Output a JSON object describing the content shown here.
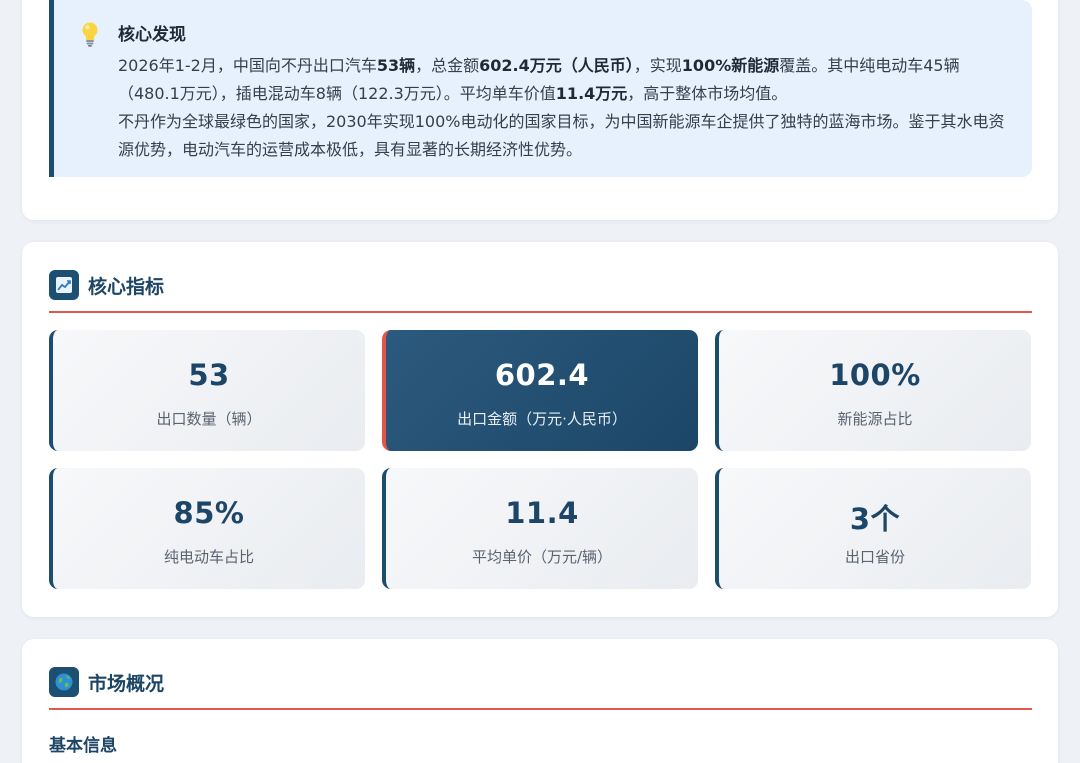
{
  "findings": {
    "icon": "lightbulb-icon",
    "title": "核心发现",
    "p1": {
      "t1": "2026年1-2月，中国向不丹出口汽车",
      "b1": "53辆",
      "t2": "，总金额",
      "b2": "602.4万元（人民币）",
      "t3": "，实现",
      "b3": "100%新能源",
      "t4": "覆盖。其中纯电动车45辆（480.1万元），插电混动车8辆（122.3万元）。平均单车价值",
      "b4": "11.4万元",
      "t5": "，高于整体市场均值。"
    },
    "p2": "不丹作为全球最绿色的国家，2030年实现100%电动化的国家目标，为中国新能源车企提供了独特的蓝海市场。鉴于其水电资源优势，电动汽车的运营成本极低，具有显著的长期经济性优势。"
  },
  "metrics_section": {
    "icon": "line-chart-icon",
    "title": "核心指标",
    "tiles": [
      {
        "value": "53",
        "label": "出口数量（辆）"
      },
      {
        "value": "602.4",
        "label": "出口金额（万元·人民币）"
      },
      {
        "value": "100%",
        "label": "新能源占比"
      },
      {
        "value": "85%",
        "label": "纯电动车占比"
      },
      {
        "value": "11.4",
        "label": "平均单价（万元/辆）"
      },
      {
        "value": "3个",
        "label": "出口省份"
      }
    ]
  },
  "market_section": {
    "icon": "globe-icon",
    "title": "市场概况",
    "subtitle": "基本信息"
  },
  "colors": {
    "primary": "#1c4c6e",
    "accent_red": "#e05a4c",
    "callout_bg": "#e6f1fd",
    "page_bg": "#eef1f6"
  }
}
